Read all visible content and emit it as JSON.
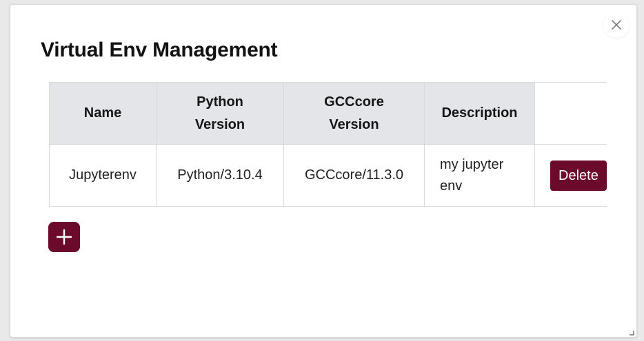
{
  "dialog": {
    "title": "Virtual Env Management",
    "close_icon": "close-icon",
    "add_icon": "plus-icon"
  },
  "table": {
    "headers": {
      "name": "Name",
      "python_version": [
        "Python",
        "Version"
      ],
      "gcccore_version": [
        "GCCcore",
        "Version"
      ],
      "description": "Description",
      "actions": ""
    },
    "rows": [
      {
        "name": "Jupyterenv",
        "python_version": "Python/3.10.4",
        "gcccore_version": "GCCcore/11.3.0",
        "description": [
          "my jupyter",
          "env"
        ],
        "delete_label": "Delete"
      }
    ]
  },
  "colors": {
    "accent": "#6b0a2a",
    "header_bg": "#e4e5e8",
    "border": "#d9d9dc"
  }
}
